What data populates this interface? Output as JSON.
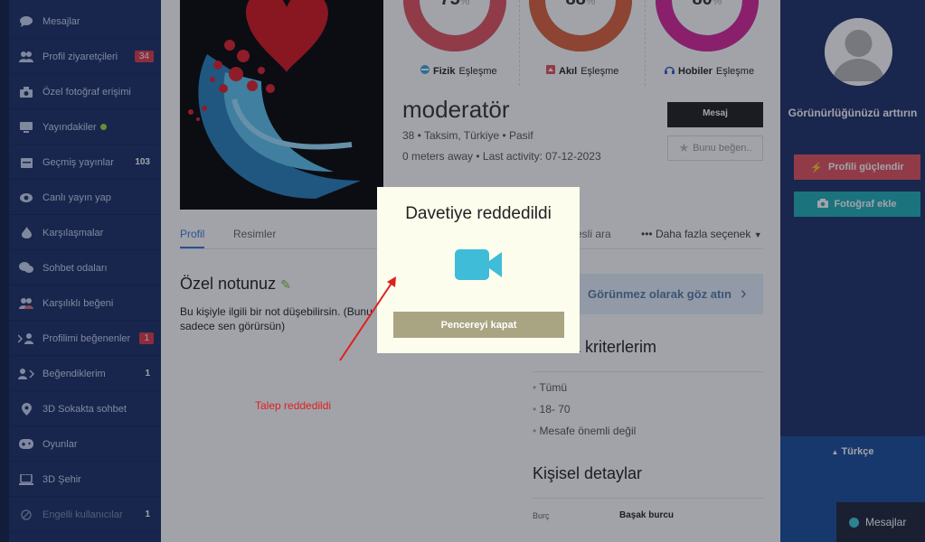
{
  "sidebar": {
    "items": [
      {
        "label": "Mesajlar",
        "icon": "chat-icon"
      },
      {
        "label": "Profil ziyaretçileri",
        "icon": "users-icon",
        "badge": "34",
        "badge_type": "red"
      },
      {
        "label": "Özel fotoğraf erişimi",
        "icon": "camera-icon"
      },
      {
        "label": "Yayındakiler",
        "icon": "tv-icon",
        "live_dot": true
      },
      {
        "label": "Geçmiş yayınlar",
        "icon": "calendar-icon",
        "badge": "103",
        "badge_type": "plain"
      },
      {
        "label": "Canlı yayın yap",
        "icon": "eye-icon"
      },
      {
        "label": "Karşılaşmalar",
        "icon": "flame-icon"
      },
      {
        "label": "Sohbet odaları",
        "icon": "chat-bubbles-icon"
      },
      {
        "label": "Karşılıklı beğeni",
        "icon": "mutual-users-icon"
      },
      {
        "label": "Profilimi beğenenler",
        "icon": "likes-me-icon",
        "badge": "1",
        "badge_type": "red"
      },
      {
        "label": "Beğendiklerim",
        "icon": "i-like-icon",
        "badge": "1",
        "badge_type": "plain"
      },
      {
        "label": "3D Sokakta sohbet",
        "icon": "map-pin-icon"
      },
      {
        "label": "Oyunlar",
        "icon": "gamepad-icon"
      },
      {
        "label": "3D Şehir",
        "icon": "laptop-icon"
      },
      {
        "label": "Engelli kullanıcılar",
        "icon": "blocked-icon",
        "badge": "1",
        "badge_type": "plain"
      }
    ]
  },
  "matches": [
    {
      "percent": "75",
      "name": "Fizik",
      "suffix": "Eşleşme",
      "color": "#e5535f",
      "accent": "#3aa6dd"
    },
    {
      "percent": "88",
      "name": "Akıl",
      "suffix": "Eşleşme",
      "color": "#e0613a",
      "accent": "#19a9b5"
    },
    {
      "percent": "80",
      "name": "Hobiler",
      "suffix": "Eşleşme",
      "color": "#d9259a",
      "accent": "#3b5fd0"
    }
  ],
  "profile": {
    "username": "moderatör",
    "info": "38 • Taksim, Türkiye • Pasif",
    "activity": "0 meters away • Last activity: 07-12-2023",
    "message_button": "Mesaj",
    "like_button": "Bunu beğen.."
  },
  "tabs": {
    "profile": "Profil",
    "pictures": "Resimler",
    "call": "Sesli ara",
    "more": "••• Daha fazla seçenek"
  },
  "note": {
    "title": "Özel notunuz",
    "text": "Bu kişiyle ilgili bir not düşebilirsin. (Bunu sadece sen görürsün)"
  },
  "ghost_button": "Görünmez olarak göz atın",
  "criteria": {
    "title": "Arama kriterlerim",
    "items": [
      "Tümü",
      "18- 70",
      "Mesafe önemli değil"
    ]
  },
  "personal": {
    "title": "Kişisel detaylar",
    "key": "Burç",
    "value": "Başak burcu"
  },
  "annotation": {
    "rejected_text": "Talep reddedildi"
  },
  "modal": {
    "title": "Davetiye reddedildi",
    "close_button": "Pencereyi kapat"
  },
  "right_panel": {
    "visibility_text": "Görünürlüğünüzü arttırın",
    "boost_button": "Profili güçlendir",
    "add_photo_button": "Fotoğraf ekle",
    "language": "Türkçe",
    "chat_bar": "Mesajlar"
  }
}
